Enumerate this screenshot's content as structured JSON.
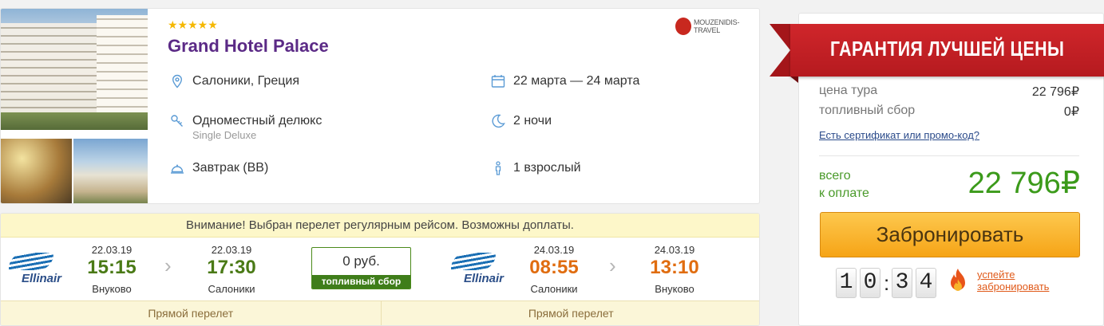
{
  "hotel": {
    "stars": "★★★★★",
    "name": "Grand Hotel Palace",
    "operator": "MOUZENIDIS-TRAVEL",
    "location": "Салоники, Греция",
    "dates": "22 марта — 24 марта",
    "room": "Одноместный делюкс",
    "room_sub": "Single Deluxe",
    "nights": "2 ночи",
    "meal": "Завтрак (BB)",
    "guests": "1 взрослый",
    "icons": {
      "location": "map-pin-icon",
      "dates": "calendar-icon",
      "room": "key-icon",
      "nights": "moon-icon",
      "meal": "cloche-icon",
      "guests": "person-icon"
    }
  },
  "flight": {
    "warning": "Внимание! Выбран перелет регулярным рейсом. Возможны доплаты.",
    "outbound": {
      "airline": "Ellinair",
      "dep_date": "22.03.19",
      "dep_time": "15:15",
      "dep_city": "Внуково",
      "arr_date": "22.03.19",
      "arr_time": "17:30",
      "arr_city": "Салоники",
      "type": "Прямой перелет"
    },
    "fuel": {
      "amount": "0 руб.",
      "label": "топливный сбор"
    },
    "inbound": {
      "airline": "Ellinair",
      "dep_date": "24.03.19",
      "dep_time": "08:55",
      "dep_city": "Салоники",
      "arr_date": "24.03.19",
      "arr_time": "13:10",
      "arr_city": "Внуково",
      "type": "Прямой перелет"
    }
  },
  "price": {
    "guarantee": "ГАРАНТИЯ ЛУЧШЕЙ ЦЕНЫ",
    "tour_label": "цена тура",
    "tour_value": "22 796₽",
    "fuel_label": "топливный сбор",
    "fuel_value": "0₽",
    "promo": "Есть сертификат или промо-код?",
    "total_label_1": "всего",
    "total_label_2": "к оплате",
    "total_value": "22 796₽",
    "book": "Забронировать",
    "timer": [
      "1",
      "0",
      "3",
      "4"
    ],
    "hurry_1": "успейте",
    "hurry_2": "забронировать"
  },
  "colors": {
    "accent": "#5b2a86",
    "green": "#3b9a1a",
    "orange": "#e06d10",
    "ribbon": "#c8222a",
    "button": "#f6a417"
  }
}
